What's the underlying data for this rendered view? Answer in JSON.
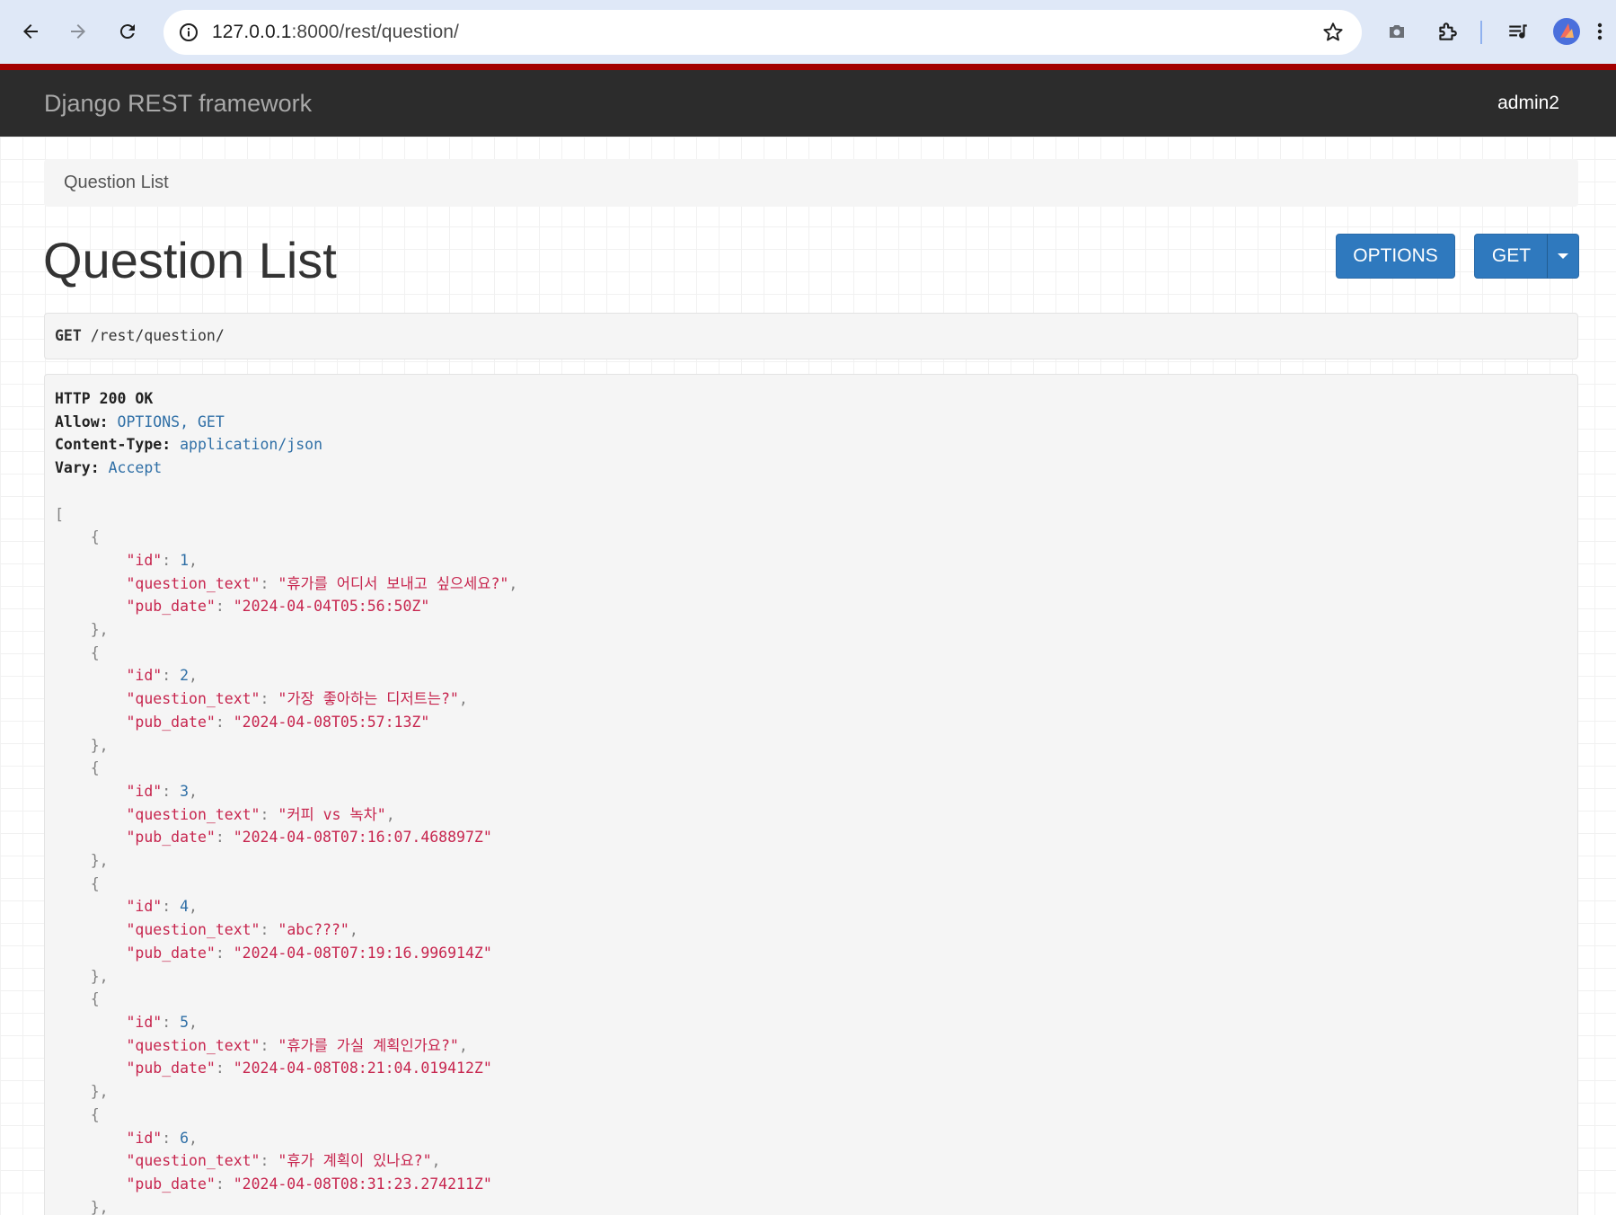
{
  "browser": {
    "url_host": "127.0.0.1",
    "url_path": ":8000/rest/question/"
  },
  "navbar": {
    "brand": "Django REST framework",
    "user": "admin2"
  },
  "breadcrumb": "Question List",
  "title": "Question List",
  "buttons": {
    "options": "OPTIONS",
    "get": "GET"
  },
  "request": {
    "method": "GET",
    "path": "/rest/question/"
  },
  "response": {
    "status": "HTTP 200 OK",
    "headers": [
      {
        "key": "Allow:",
        "value": "OPTIONS, GET"
      },
      {
        "key": "Content-Type:",
        "value": "application/json"
      },
      {
        "key": "Vary:",
        "value": "Accept"
      }
    ],
    "items": [
      {
        "id": "1",
        "question_text": "휴가를 어디서 보내고 싶으세요?",
        "pub_date": "2024-04-04T05:56:50Z"
      },
      {
        "id": "2",
        "question_text": "가장 좋아하는 디저트는?",
        "pub_date": "2024-04-08T05:57:13Z"
      },
      {
        "id": "3",
        "question_text": "커피 vs 녹차",
        "pub_date": "2024-04-08T07:16:07.468897Z"
      },
      {
        "id": "4",
        "question_text": "abc???",
        "pub_date": "2024-04-08T07:19:16.996914Z"
      },
      {
        "id": "5",
        "question_text": "휴가를 가실 계획인가요?",
        "pub_date": "2024-04-08T08:21:04.019412Z"
      },
      {
        "id": "6",
        "question_text": "휴가 계획이 있나요?",
        "pub_date": "2024-04-08T08:31:23.274211Z"
      }
    ]
  },
  "colors": {
    "navbar_bg": "#2c2c2c",
    "accent_red": "#a30000",
    "button_blue": "#2f79be",
    "json_string": "#c7254e",
    "json_number": "#2f6fa6"
  },
  "icons": [
    "back-arrow-icon",
    "forward-arrow-icon",
    "reload-icon",
    "site-info-icon",
    "bookmark-star-icon",
    "camera-icon",
    "extensions-puzzle-icon",
    "media-queue-icon",
    "profile-avatar-icon",
    "caret-down-icon"
  ]
}
